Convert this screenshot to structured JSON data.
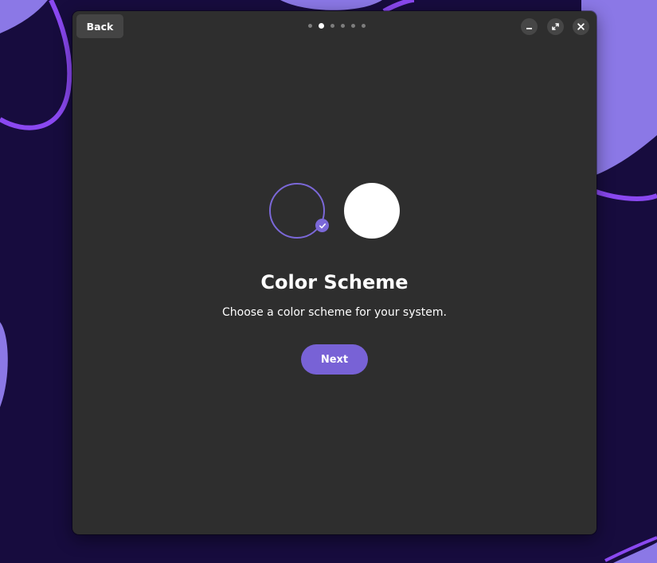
{
  "header": {
    "back_label": "Back",
    "progress": {
      "total_steps": 6,
      "current_step": 2
    }
  },
  "window_controls": {
    "minimize_icon": "minimize-icon",
    "maximize_icon": "maximize-icon",
    "close_icon": "close-icon"
  },
  "color_scheme": {
    "options": [
      {
        "id": "dark",
        "selected": true,
        "color": "#2e2e2e"
      },
      {
        "id": "light",
        "selected": false,
        "color": "#ffffff"
      }
    ],
    "selected_icon": "checkmark-icon"
  },
  "main": {
    "title": "Color Scheme",
    "subtitle": "Choose a color scheme for your system.",
    "next_label": "Next"
  },
  "colors": {
    "accent": "#7862d6",
    "window_bg": "#2e2e2e",
    "desktop_bg": "#170c3e",
    "wallpaper_shape": "#8b78e6",
    "wallpaper_stroke": "#8a48f0"
  }
}
